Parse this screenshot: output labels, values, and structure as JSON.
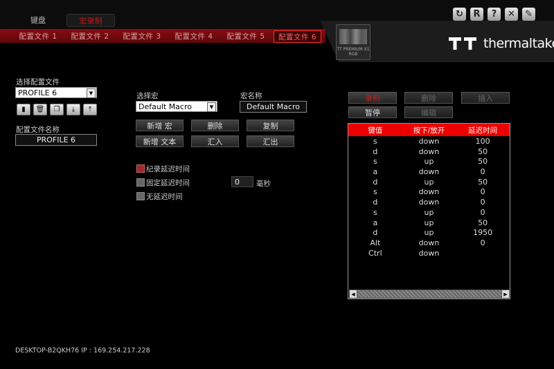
{
  "top_tabs": {
    "keyboard": "键盘",
    "macro": "宏录制"
  },
  "profile_tabs": [
    "配置文件 1",
    "配置文件 2",
    "配置文件 3",
    "配置文件 4",
    "配置文件 5",
    "配置文件 6"
  ],
  "device": {
    "label": "TT PREMIUM X1 RGB"
  },
  "brand": {
    "name": "thermaltake"
  },
  "window_buttons": {
    "refresh": "↻",
    "reset": "R",
    "help": "?",
    "close": "✕",
    "tools": "✎"
  },
  "left": {
    "select_profile_label": "选择配置文件",
    "selected_profile": "PROFILE 6",
    "profile_name_label": "配置文件名称",
    "profile_name": "PROFILE 6"
  },
  "macro": {
    "select_label": "选择宏",
    "selected_macro": "Default Macro",
    "name_label": "宏名称",
    "name_value": "Default Macro",
    "buttons": {
      "new_macro": "新增 宏",
      "delete": "删除",
      "copy": "复制",
      "new_text": "新增 文本",
      "import": "汇入",
      "export": "汇出"
    },
    "options": {
      "record_delay": "纪录延迟时间",
      "fixed_delay": "固定延迟时间",
      "no_delay": "无延迟时间"
    },
    "fixed_delay_value": "0",
    "ms_unit": "毫秒"
  },
  "record": {
    "buttons": {
      "record": "录制",
      "delete": "删除",
      "insert": "插入",
      "pause": "暂停",
      "edit": "编辑"
    },
    "table": {
      "headers": [
        "键值",
        "按下/放开",
        "延迟时间"
      ],
      "rows": [
        [
          "s",
          "down",
          "100"
        ],
        [
          "d",
          "down",
          "50"
        ],
        [
          "s",
          "up",
          "50"
        ],
        [
          "a",
          "down",
          "0"
        ],
        [
          "d",
          "up",
          "50"
        ],
        [
          "s",
          "down",
          "0"
        ],
        [
          "d",
          "down",
          "0"
        ],
        [
          "s",
          "up",
          "0"
        ],
        [
          "a",
          "up",
          "50"
        ],
        [
          "d",
          "up",
          "1950"
        ],
        [
          "Alt",
          "down",
          "0"
        ],
        [
          "Ctrl",
          "down",
          ""
        ]
      ]
    }
  },
  "footer": "DESKTOP-B2QKH76 IP : 169.254.217.228"
}
